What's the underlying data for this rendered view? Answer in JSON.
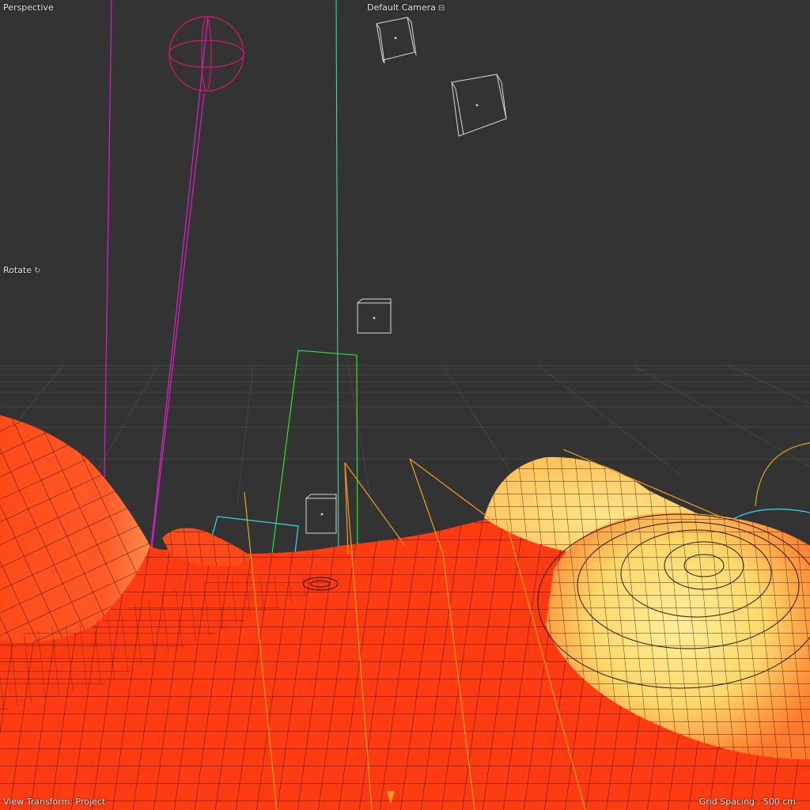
{
  "viewport": {
    "view_name": "Perspective",
    "camera_name": "Default Camera",
    "camera_icon": "camera-link-icon",
    "tool_name": "Rotate",
    "tool_icon": "rotate-icon",
    "view_transform": "View Transform: Project",
    "grid_spacing": "Grid Spacing : 500 cm"
  },
  "colors": {
    "background": "#333333",
    "mesh_red": "#ff3b12",
    "mesh_yellow": "#ffe680",
    "light_magenta": "#d020c0",
    "guide_green": "#30e030",
    "guide_teal": "#4fd1a0",
    "spline_orange": "#f0a020",
    "spline_cyan": "#30d0e0",
    "null_white": "#d8d8d8"
  }
}
